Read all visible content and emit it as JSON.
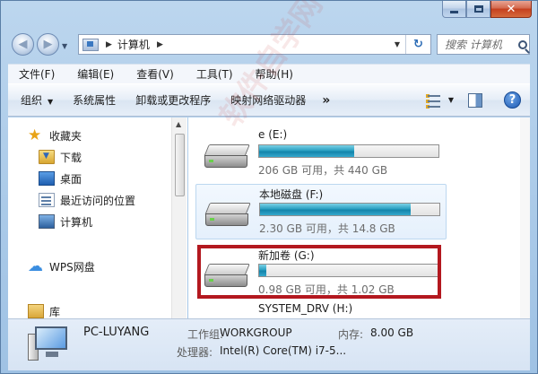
{
  "window": {
    "controls": {
      "minimize": "",
      "maximize": "",
      "close": "✕"
    }
  },
  "navigation": {
    "back_glyph": "◀",
    "forward_glyph": "▶",
    "breadcrumb": [
      "计算机"
    ],
    "refresh_glyph": "↻",
    "search_placeholder": "搜索 计算机"
  },
  "menubar": {
    "items": [
      "文件(F)",
      "编辑(E)",
      "查看(V)",
      "工具(T)",
      "帮助(H)"
    ]
  },
  "toolbar": {
    "items": [
      "组织",
      "系统属性",
      "卸载或更改程序",
      "映射网络驱动器"
    ],
    "more": "»",
    "help": "?"
  },
  "sidebar": {
    "favorites": "收藏夹",
    "items": [
      "下载",
      "桌面",
      "最近访问的位置"
    ],
    "computer": "计算机",
    "wps": "WPS网盘",
    "library": "库"
  },
  "drives": [
    {
      "name": "e (E:)",
      "info": "206 GB 可用，共 440 GB",
      "used_fraction": 0.53,
      "highlighted": false
    },
    {
      "name": "本地磁盘 (F:)",
      "info": "2.30 GB 可用，共 14.8 GB",
      "used_fraction": 0.84,
      "highlighted": true
    },
    {
      "name": "新加卷 (G:)",
      "info": "0.98 GB 可用，共 1.02 GB",
      "used_fraction": 0.04,
      "highlighted": false
    },
    {
      "name": "SYSTEM_DRV (H:)",
      "info": "",
      "used_fraction": null,
      "highlighted": false
    }
  ],
  "details": {
    "pc_name": "PC-LUYANG",
    "workgroup_label": "工作组:",
    "workgroup_value": "WORKGROUP",
    "memory_label": "内存:",
    "memory_value": "8.00 GB",
    "cpu_label": "处理器:",
    "cpu_value": "Intel(R) Core(TM) i7-5..."
  },
  "annotation": {
    "color": "#b3181f"
  },
  "watermark": "软件自学网"
}
